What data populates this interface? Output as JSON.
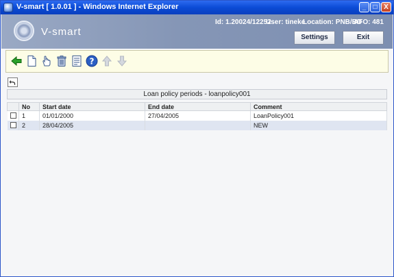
{
  "window": {
    "title": "V-smart [ 1.0.01 ] - Windows Internet Explorer",
    "minimize": "_",
    "maximize": "□",
    "close": "X"
  },
  "header": {
    "logo_text": "V-smart",
    "id_text": "Id: 1.20024/12252",
    "user_text": "User: tineke",
    "location_text": "Location: PNB/BD",
    "afo_text": "AFO: 481",
    "settings_label": "Settings",
    "exit_label": "Exit"
  },
  "toolbar": {
    "icons": [
      "back-arrow-icon",
      "new-document-icon",
      "select-hand-icon",
      "delete-bin-icon",
      "list-details-icon",
      "help-icon",
      "move-up-icon",
      "move-down-icon"
    ]
  },
  "grid": {
    "title": "Loan policy periods - loanpolicy001",
    "columns": [
      "No",
      "Start date",
      "End date",
      "Comment"
    ],
    "rows": [
      {
        "no": "1",
        "start": "01/01/2000",
        "end": "27/04/2005",
        "comment": "LoanPolicy001"
      },
      {
        "no": "2",
        "start": "28/04/2005",
        "end": "",
        "comment": "NEW"
      }
    ]
  },
  "colors": {
    "titlebar": "#0b4bd6",
    "header": "#8596b6",
    "toolbar_bg": "#fdfde6",
    "row_alt": "#dfe5f1"
  }
}
